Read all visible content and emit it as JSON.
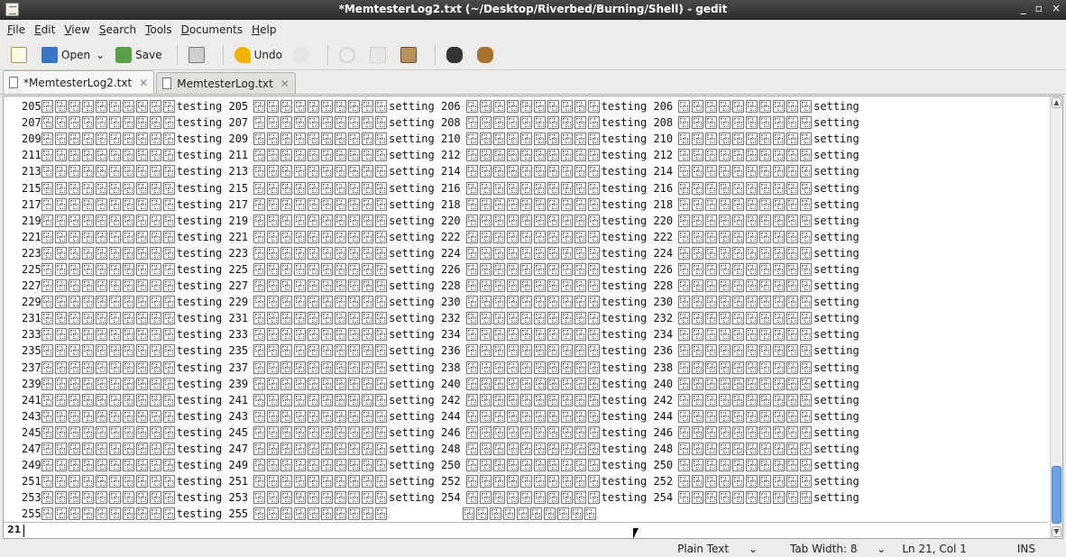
{
  "window": {
    "title": "*MemtesterLog2.txt (~/Desktop/Riverbed/Burning/Shell) - gedit",
    "controls": [
      "_",
      "▫",
      "×"
    ]
  },
  "menu": [
    "File",
    "Edit",
    "View",
    "Search",
    "Tools",
    "Documents",
    "Help"
  ],
  "toolbar": {
    "open": "Open",
    "save": "Save",
    "undo": "Undo"
  },
  "tabs": [
    {
      "label": "*MemtesterLog2.txt",
      "active": true
    },
    {
      "label": "MemtesterLog.txt",
      "active": false
    }
  ],
  "editor": {
    "lines": [
      [
        "205",
        "testing 205",
        "setting 206",
        "testing 206",
        "setting"
      ],
      [
        "207",
        "testing 207",
        "setting 208",
        "testing 208",
        "setting"
      ],
      [
        "209",
        "testing 209",
        "setting 210",
        "testing 210",
        "setting"
      ],
      [
        "211",
        "testing 211",
        "setting 212",
        "testing 212",
        "setting"
      ],
      [
        "213",
        "testing 213",
        "setting 214",
        "testing 214",
        "setting"
      ],
      [
        "215",
        "testing 215",
        "setting 216",
        "testing 216",
        "setting"
      ],
      [
        "217",
        "testing 217",
        "setting 218",
        "testing 218",
        "setting"
      ],
      [
        "219",
        "testing 219",
        "setting 220",
        "testing 220",
        "setting"
      ],
      [
        "221",
        "testing 221",
        "setting 222",
        "testing 222",
        "setting"
      ],
      [
        "223",
        "testing 223",
        "setting 224",
        "testing 224",
        "setting"
      ],
      [
        "225",
        "testing 225",
        "setting 226",
        "testing 226",
        "setting"
      ],
      [
        "227",
        "testing 227",
        "setting 228",
        "testing 228",
        "setting"
      ],
      [
        "229",
        "testing 229",
        "setting 230",
        "testing 230",
        "setting"
      ],
      [
        "231",
        "testing 231",
        "setting 232",
        "testing 232",
        "setting"
      ],
      [
        "233",
        "testing 233",
        "setting 234",
        "testing 234",
        "setting"
      ],
      [
        "235",
        "testing 235",
        "setting 236",
        "testing 236",
        "setting"
      ],
      [
        "237",
        "testing 237",
        "setting 238",
        "testing 238",
        "setting"
      ],
      [
        "239",
        "testing 239",
        "setting 240",
        "testing 240",
        "setting"
      ],
      [
        "241",
        "testing 241",
        "setting 242",
        "testing 242",
        "setting"
      ],
      [
        "243",
        "testing 243",
        "setting 244",
        "testing 244",
        "setting"
      ],
      [
        "245",
        "testing 245",
        "setting 246",
        "testing 246",
        "setting"
      ],
      [
        "247",
        "testing 247",
        "setting 248",
        "testing 248",
        "setting"
      ],
      [
        "249",
        "testing 249",
        "setting 250",
        "testing 250",
        "setting"
      ],
      [
        "251",
        "testing 251",
        "setting 252",
        "testing 252",
        "setting"
      ],
      [
        "253",
        "testing 253",
        "setting 254",
        "testing 254",
        "setting"
      ],
      [
        "255",
        "testing 255",
        "",
        "",
        ""
      ]
    ],
    "current_line_number": "21"
  },
  "statusbar": {
    "language": "Plain Text",
    "tab_width": "Tab Width:  8",
    "position": "Ln 21, Col 1",
    "mode": "INS"
  }
}
